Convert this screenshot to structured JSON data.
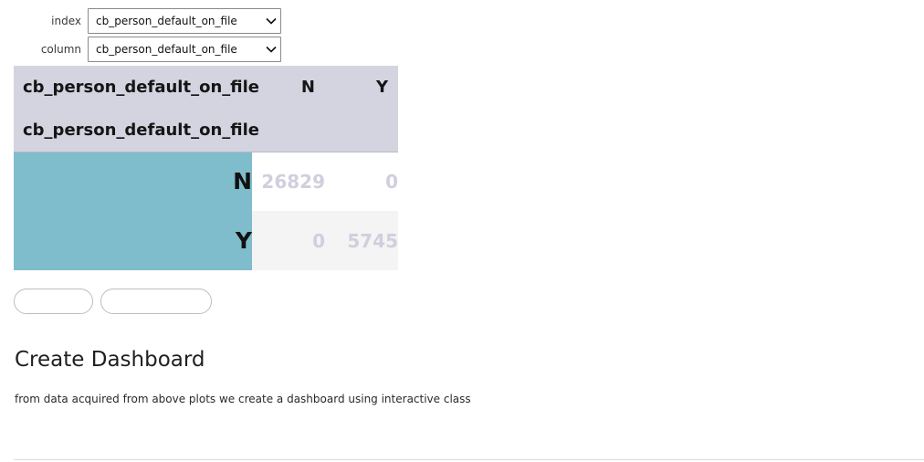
{
  "controls": {
    "index": {
      "label": "index",
      "value": "cb_person_default_on_file"
    },
    "column": {
      "label": "column",
      "value": "cb_person_default_on_file"
    }
  },
  "pivot": {
    "column_header_name": "cb_person_default_on_file",
    "index_header_name": "cb_person_default_on_file",
    "columns": [
      "N",
      "Y"
    ],
    "rows": [
      {
        "label": "N",
        "values": [
          "26829",
          "0"
        ]
      },
      {
        "label": "Y",
        "values": [
          "0",
          "5745"
        ]
      }
    ]
  },
  "buttons": {
    "first_label": "",
    "second_label": ""
  },
  "section": {
    "heading": "Create Dashboard",
    "text": "from data acquired from above plots we create a dashboard using interactive class"
  },
  "colors": {
    "header_bg": "#d4d3e0",
    "row_header_bg": "#7fbccc",
    "value_text": "#cfcfde",
    "alt_row_bg": "#f4f4f4"
  },
  "icons": {
    "select_arrow": "chevron-down-icon"
  }
}
